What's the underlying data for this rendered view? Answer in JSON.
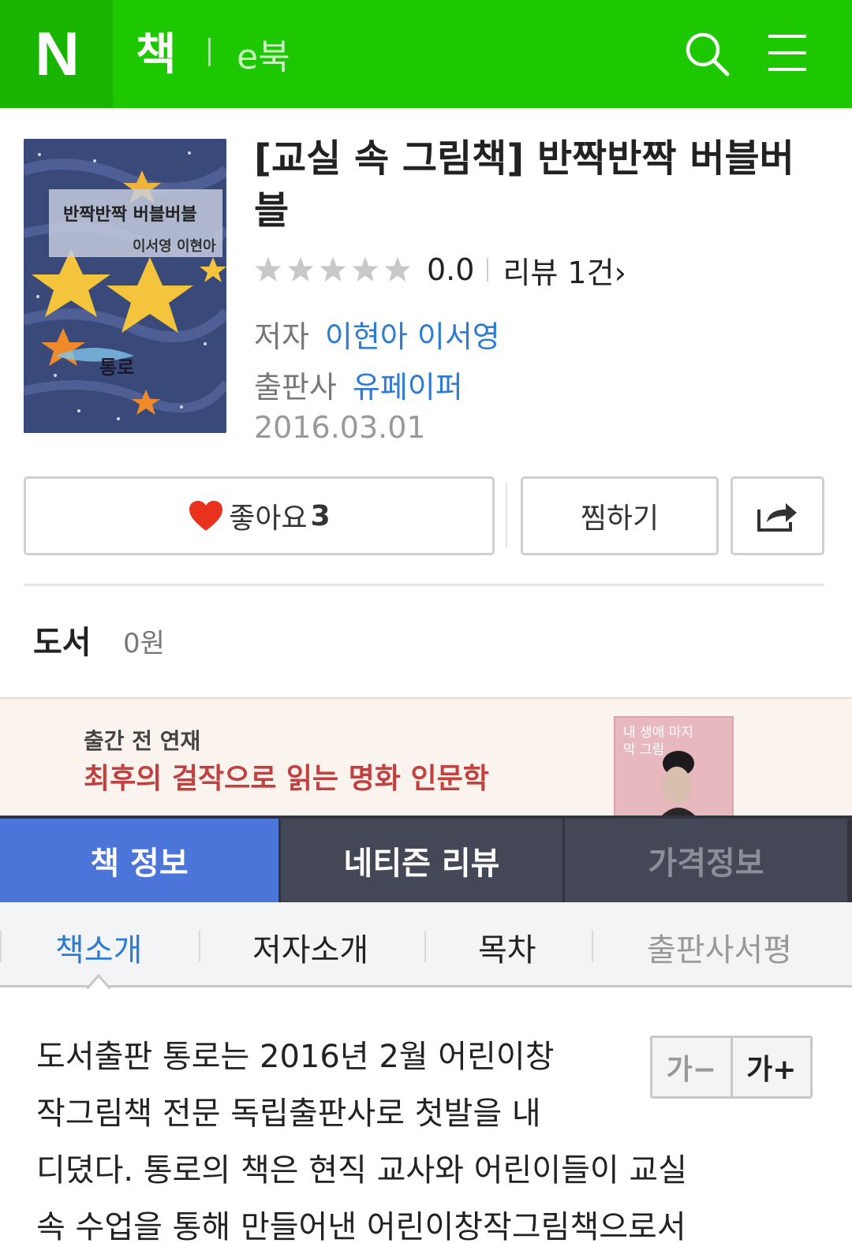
{
  "header": {
    "logo": "N",
    "title": "책",
    "subtitle": "e북"
  },
  "book": {
    "title": "[교실 속 그림책] 반짝반짝 버블버블",
    "cover_title": "반짝반짝 버블버블",
    "cover_authors": "이서영 이현아",
    "cover_publisher": "통로",
    "rating": "0.0",
    "rating_value": 0,
    "rating_max": 5,
    "review_label": "리뷰 1건›",
    "author_label": "저자",
    "author": "이현아 이서영",
    "publisher_label": "출판사",
    "publisher": "유페이퍼",
    "date": "2016.03.01"
  },
  "actions": {
    "like_label": "좋아요",
    "like_count": "3",
    "wish_label": "찜하기"
  },
  "price": {
    "label": "도서",
    "value": "0원"
  },
  "banner": {
    "small": "출간 전 연재",
    "big": "최후의 걸작으로 읽는 명화 인문학",
    "book_title": "내 생애 마지막 그림"
  },
  "tabs": [
    {
      "label": "책 정보"
    },
    {
      "label": "네티즌 리뷰"
    },
    {
      "label": "가격정보"
    }
  ],
  "subtabs": [
    {
      "label": "책소개"
    },
    {
      "label": "저자소개"
    },
    {
      "label": "목차"
    },
    {
      "label": "출판사서평"
    }
  ],
  "font_control": {
    "decrease": "가−",
    "increase": "가+"
  },
  "intro_lines": [
    "도서출판 통로는 2016년 2월 어린이창",
    "작그림책 전문 독립출판사로 첫발을 내",
    "디뎠다. 통로의 책은 현직 교사와 어린이들이 교실",
    "속 수업을 통해 만들어낸 어린이창작그림책으로서"
  ],
  "colors": {
    "brand_green": "#1ec800",
    "link_blue": "#2d7bd3",
    "tab_active": "#4c75d9",
    "tab_dark": "#444856",
    "heart_red": "#e8321e"
  }
}
